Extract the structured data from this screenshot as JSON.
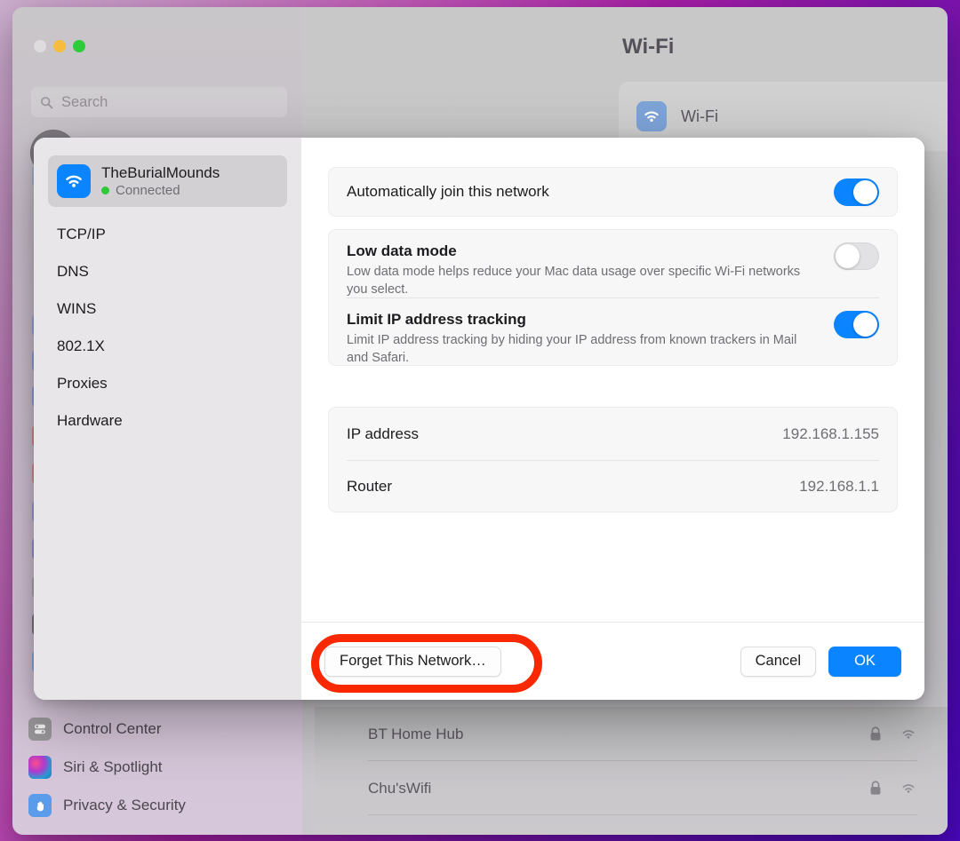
{
  "window": {
    "traffic_lights": [
      "close",
      "minimize",
      "maximize"
    ],
    "search_placeholder": "Search",
    "panel_title": "Wi-Fi",
    "wifi_row_label": "Wi-Fi",
    "wifi_toggle_on": true
  },
  "background_sidebar": {
    "items": [
      {
        "label": "Control Center",
        "icon": "control-center-icon",
        "color": "#9a989b"
      },
      {
        "label": "Siri & Spotlight",
        "icon": "siri-icon",
        "color": "#6a4fa0"
      },
      {
        "label": "Privacy & Security",
        "icon": "privacy-hand-icon",
        "color": "#5a9bea"
      }
    ]
  },
  "background_networks": [
    {
      "name": "BT Home Hub",
      "secured": true,
      "signal": "wifi-full-icon"
    },
    {
      "name": "Chu'sWifi",
      "secured": true,
      "signal": "wifi-full-icon"
    }
  ],
  "sheet": {
    "network": {
      "name": "TheBurialMounds",
      "status": "Connected",
      "status_color": "#2dc937",
      "icon": "wifi-icon",
      "icon_color": "#0a84ff"
    },
    "sidebar_items": [
      {
        "label": "TCP/IP"
      },
      {
        "label": "DNS"
      },
      {
        "label": "WINS"
      },
      {
        "label": "802.1X"
      },
      {
        "label": "Proxies"
      },
      {
        "label": "Hardware"
      }
    ],
    "settings": {
      "auto_join": {
        "title": "Automatically join this network",
        "toggle_on": true
      },
      "low_data_mode": {
        "title": "Low data mode",
        "description": "Low data mode helps reduce your Mac data usage over specific Wi-Fi networks you select.",
        "toggle_on": false
      },
      "limit_ip_tracking": {
        "title": "Limit IP address tracking",
        "description": "Limit IP address tracking by hiding your IP address from known trackers in Mail and Safari.",
        "toggle_on": true
      }
    },
    "details": [
      {
        "key": "IP address",
        "value": "192.168.1.155"
      },
      {
        "key": "Router",
        "value": "192.168.1.1"
      }
    ],
    "footer": {
      "forget_label": "Forget This Network…",
      "cancel_label": "Cancel",
      "ok_label": "OK"
    }
  },
  "annotation": {
    "shape": "ellipse-ring",
    "color": "#fa2800",
    "target": "forget-this-network-button"
  },
  "theme": {
    "accent_blue": "#0a84ff",
    "sheet_bg": "#ffffff",
    "sheet_sidebar_bg": "#e9e6ea",
    "card_bg": "#f7f7f8",
    "text_primary": "#1c1c1e",
    "text_secondary": "#6e6e73"
  }
}
